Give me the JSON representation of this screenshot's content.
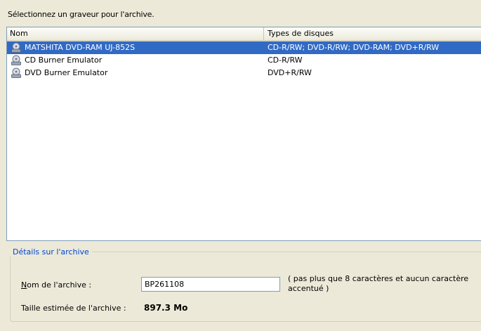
{
  "instruction": "Sélectionnez un graveur pour l'archive.",
  "list": {
    "columns": [
      "Nom",
      "Types de disques"
    ],
    "rows": [
      {
        "name": "MATSHITA DVD-RAM UJ-852S",
        "types": "CD-R/RW; DVD-R/RW; DVD-RAM; DVD+R/RW",
        "selected": true,
        "icon": "drive-icon"
      },
      {
        "name": "CD Burner Emulator",
        "types": "CD-R/RW",
        "selected": false,
        "icon": "drive-icon"
      },
      {
        "name": "DVD Burner Emulator",
        "types": "DVD+R/RW",
        "selected": false,
        "icon": "drive-icon"
      }
    ]
  },
  "details": {
    "title": "Détails sur l'archive",
    "archive_name_label_u": "N",
    "archive_name_label_rest": "om de l'archive :",
    "archive_name_value": "BP261108",
    "hint": "( pas plus que 8 caractères et aucun caractère accentué )",
    "size_label": "Taille estimée de l'archive :",
    "size_value": "897.3 Mo"
  },
  "colors": {
    "selection": "#316ac5",
    "group_title": "#0046d5",
    "background": "#ece9d8"
  }
}
